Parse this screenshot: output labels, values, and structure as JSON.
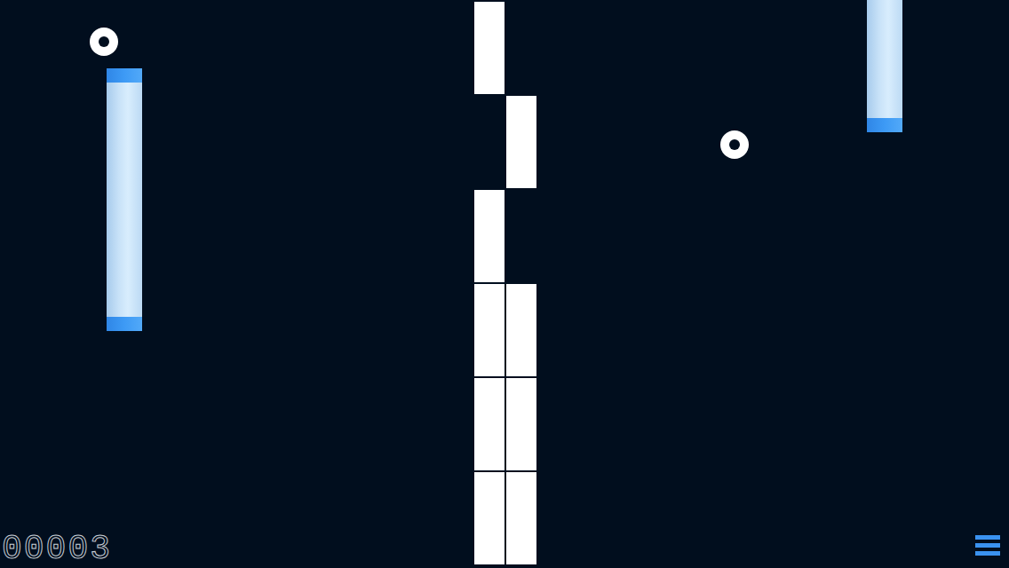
{
  "score": "00003",
  "wall": {
    "rows": [
      [
        {
          "filled": true
        },
        {
          "filled": false
        }
      ],
      [
        {
          "filled": false
        },
        {
          "filled": true
        }
      ],
      [
        {
          "filled": true
        },
        {
          "filled": false
        }
      ],
      [
        {
          "filled": true
        },
        {
          "filled": true
        }
      ],
      [
        {
          "filled": true
        },
        {
          "filled": true
        }
      ],
      [
        {
          "filled": true
        },
        {
          "filled": true
        }
      ]
    ]
  }
}
